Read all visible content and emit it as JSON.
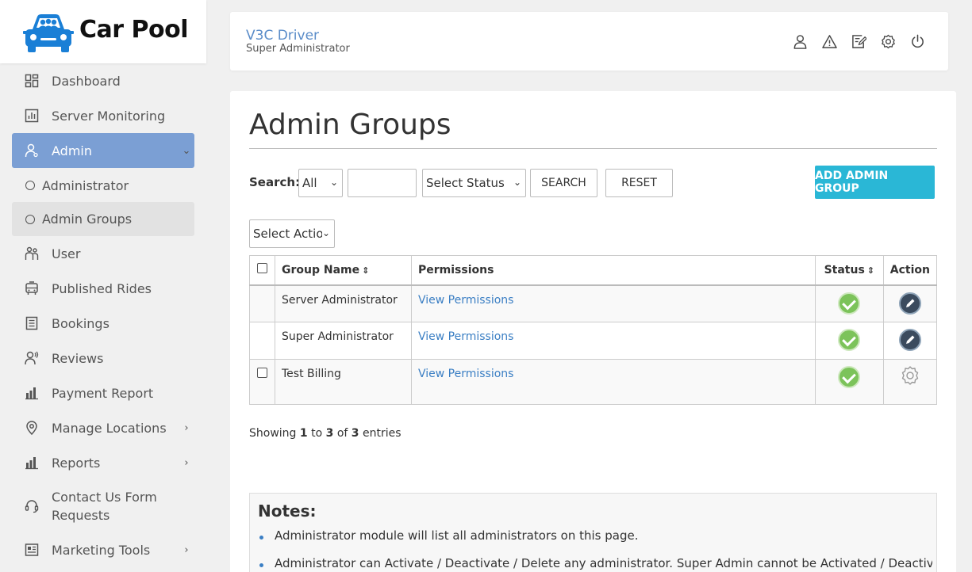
{
  "app": {
    "name": "Car Pool",
    "logo_icon": "car-pool-logo"
  },
  "sidebar": {
    "items": [
      {
        "label": "Dashboard",
        "icon": "dashboard-icon"
      },
      {
        "label": "Server Monitoring",
        "icon": "chart-icon"
      },
      {
        "label": "Admin",
        "icon": "admin-icon",
        "expanded": true
      },
      {
        "label": "Administrator",
        "icon": "circle-icon"
      },
      {
        "label": "Admin Groups",
        "icon": "circle-icon",
        "selected": true
      },
      {
        "label": "User",
        "icon": "users-icon"
      },
      {
        "label": "Published Rides",
        "icon": "bus-icon"
      },
      {
        "label": "Bookings",
        "icon": "document-icon"
      },
      {
        "label": "Reviews",
        "icon": "reviews-icon"
      },
      {
        "label": "Payment Report",
        "icon": "bar-chart-icon"
      },
      {
        "label": "Manage Locations",
        "icon": "location-icon"
      },
      {
        "label": "Reports",
        "icon": "bar-chart-icon"
      },
      {
        "label": "Contact Us Form Requests",
        "label_line1": "Contact Us Form",
        "label_line2": "Requests",
        "icon": "headset-icon"
      },
      {
        "label": "Marketing Tools",
        "icon": "newspaper-icon"
      }
    ],
    "active_color": "#7b9fd4"
  },
  "header": {
    "title": "V3C Driver",
    "subtitle": "Super Administrator",
    "icons": [
      "user-icon",
      "warning-icon",
      "edit-icon",
      "settings-icon",
      "power-icon"
    ]
  },
  "main": {
    "title": "Admin Groups",
    "search": {
      "label": "Search:",
      "field_select": "All",
      "query": "",
      "status_select": "Select Status",
      "search_button": "SEARCH",
      "reset_button": "RESET",
      "add_button": "ADD ADMIN GROUP"
    },
    "bulk_action": "Select Action",
    "table": {
      "columns": [
        "Group Name",
        "Permissions",
        "Status",
        "Action"
      ],
      "rows": [
        {
          "group_name": "Server Administrator",
          "permissions": "View Permissions",
          "status": "active",
          "action": "edit",
          "checkbox": false
        },
        {
          "group_name": "Super Administrator",
          "permissions": "View Permissions",
          "status": "active",
          "action": "edit",
          "checkbox": false
        },
        {
          "group_name": "Test Billing",
          "permissions": "View Permissions",
          "status": "active",
          "action": "settings",
          "checkbox": true
        }
      ]
    },
    "showing": {
      "prefix": "Showing",
      "from": "1",
      "to_word": "to",
      "to": "3",
      "of_word": "of",
      "total": "3",
      "suffix": "entries"
    },
    "notes": {
      "title": "Notes:",
      "items": [
        "Administrator module will list all administrators on this page.",
        "Administrator can Activate / Deactivate / Delete any administrator. Super Admin cannot be Activated / Deactivated /"
      ]
    },
    "colors": {
      "primary_button": "#2ab7d6",
      "link": "#3b7fc4",
      "status_active": "#7cc35a"
    }
  }
}
